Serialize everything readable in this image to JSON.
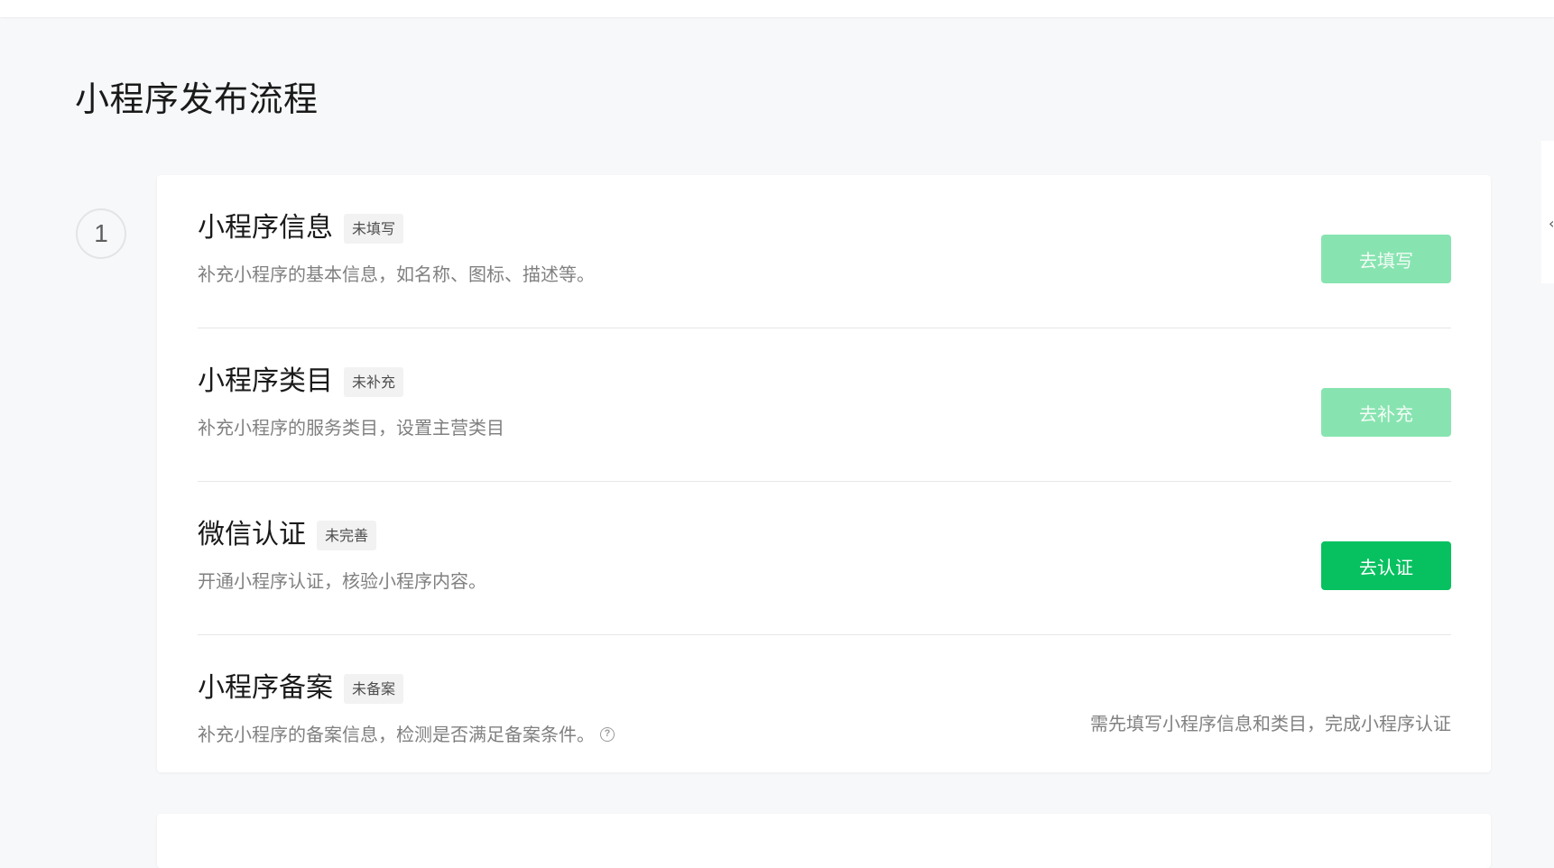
{
  "page": {
    "title": "小程序发布流程"
  },
  "step": {
    "number": "1"
  },
  "rows": [
    {
      "title": "小程序信息",
      "badge": "未填写",
      "description": "补充小程序的基本信息，如名称、图标、描述等。",
      "button_label": "去填写",
      "button_state": "disabled"
    },
    {
      "title": "小程序类目",
      "badge": "未补充",
      "description": "补充小程序的服务类目，设置主营类目",
      "button_label": "去补充",
      "button_state": "disabled"
    },
    {
      "title": "微信认证",
      "badge": "未完善",
      "description": "开通小程序认证，核验小程序内容。",
      "button_label": "去认证",
      "button_state": "enabled"
    },
    {
      "title": "小程序备案",
      "badge": "未备案",
      "description": "补充小程序的备案信息，检测是否满足备案条件。",
      "note": "需先填写小程序信息和类目，完成小程序认证",
      "help_icon": "question-circle-icon"
    }
  ],
  "colors": {
    "primary": "#07c160",
    "primary_disabled": "#87e4b0",
    "background": "#f7f8fa"
  }
}
